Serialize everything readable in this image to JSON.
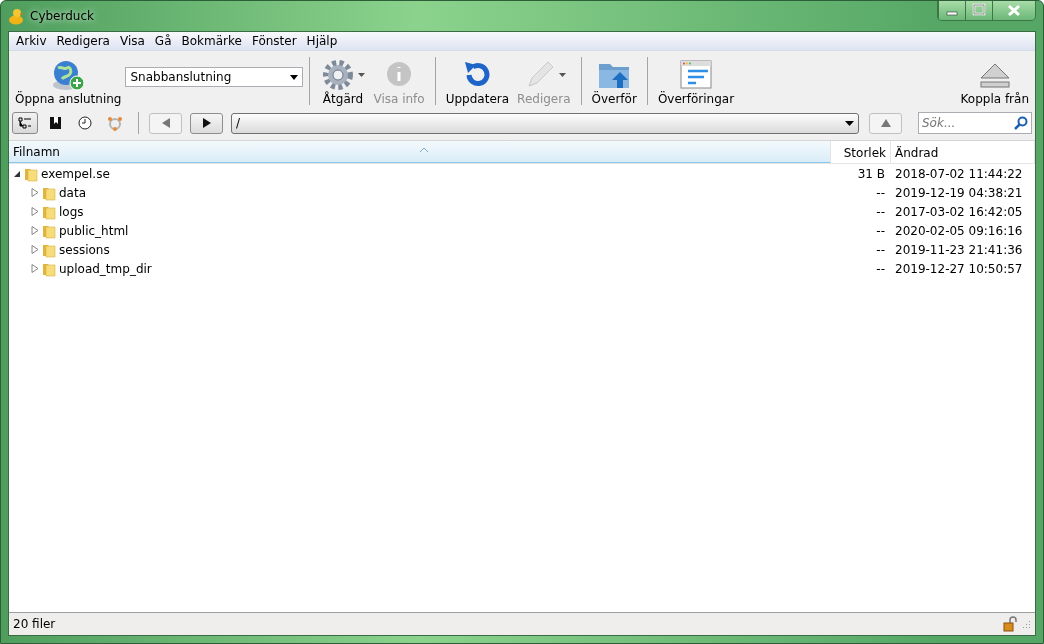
{
  "window": {
    "title": "Cyberduck"
  },
  "menu": [
    "Arkiv",
    "Redigera",
    "Visa",
    "Gå",
    "Bokmärke",
    "Fönster",
    "Hjälp"
  ],
  "toolbar": {
    "left": [
      {
        "kind": "button",
        "label": "Öppna anslutning",
        "disabled": false,
        "dropdown": false
      },
      {
        "kind": "combo",
        "value": "Snabbanslutning"
      },
      {
        "kind": "button",
        "label": "Åtgärd",
        "disabled": false,
        "dropdown": true
      },
      {
        "kind": "button",
        "label": "Visa info",
        "disabled": true,
        "dropdown": false
      },
      {
        "kind": "button",
        "label": "Uppdatera",
        "disabled": false,
        "dropdown": false
      },
      {
        "kind": "button",
        "label": "Redigera",
        "disabled": true,
        "dropdown": true
      },
      {
        "kind": "button",
        "label": "Överför",
        "disabled": false,
        "dropdown": false
      },
      {
        "kind": "button",
        "label": "Överföringar",
        "disabled": false,
        "dropdown": false
      }
    ],
    "right": [
      {
        "kind": "button",
        "label": "Koppla från",
        "disabled": false,
        "dropdown": false
      }
    ]
  },
  "view_buttons": [
    {
      "selected": true
    },
    {
      "selected": false
    },
    {
      "selected": false
    },
    {
      "selected": false
    }
  ],
  "nav": {
    "back_disabled": true,
    "forward_disabled": false,
    "path": "/",
    "up_disabled": true
  },
  "search": {
    "placeholder": "Sök..."
  },
  "table": {
    "columns": [
      {
        "label": "Filnamn",
        "selected": true
      },
      {
        "label": "Storlek",
        "selected": false
      },
      {
        "label": "Ändrad",
        "selected": false
      }
    ],
    "rows": [
      {
        "name": "exempel.se",
        "size": "31 B",
        "modified": "2018-07-02 11:44:22",
        "expanded": true,
        "children": [
          {
            "name": "data",
            "size": "--",
            "modified": "2019-12-19 04:38:21",
            "expanded": false
          },
          {
            "name": "logs",
            "size": "--",
            "modified": "2017-03-02 16:42:05",
            "expanded": false
          },
          {
            "name": "public_html",
            "size": "--",
            "modified": "2020-02-05 09:16:16",
            "expanded": false
          },
          {
            "name": "sessions",
            "size": "--",
            "modified": "2019-11-23 21:41:36",
            "expanded": false
          },
          {
            "name": "upload_tmp_dir",
            "size": "--",
            "modified": "2019-12-27 10:50:57",
            "expanded": false
          }
        ]
      }
    ]
  },
  "status_bar": {
    "text": "20 filer"
  }
}
